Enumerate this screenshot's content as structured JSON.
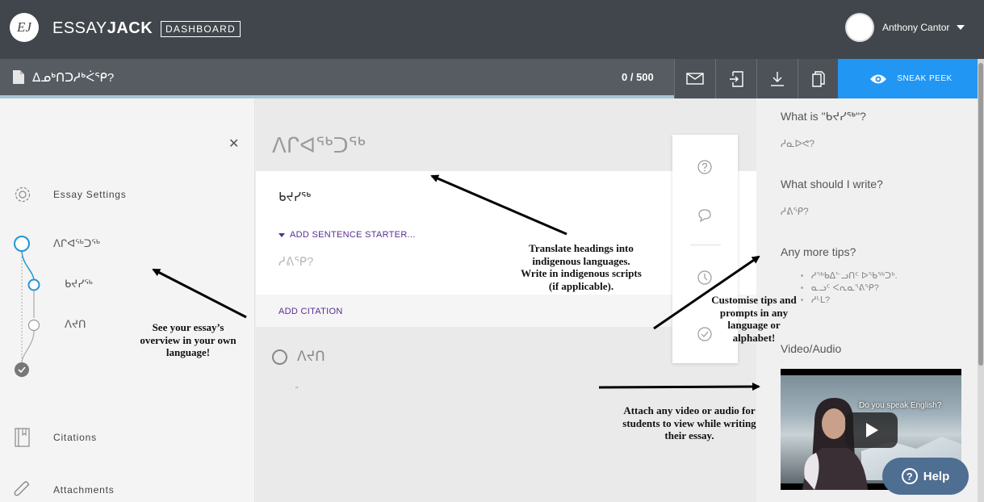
{
  "header": {
    "logo_text": "EJ",
    "brand_light": "ESSAY",
    "brand_bold": "JACK",
    "dashboard_label": "DASHBOARD",
    "user_name": "Anthony Cantor"
  },
  "docbar": {
    "title": "ᐃᓄᒃᑎᑐᓱᒃᐹᕿ?",
    "word_count": "0 / 500",
    "sneak_peek_label": "SNEAK PEEK"
  },
  "sidebar": {
    "settings_label": "Essay Settings",
    "outline": [
      "ᐱᒋᐊᖅᑐᖅ",
      "ᑲᔪᓯᖅ",
      "ᐱᔪᑎ"
    ],
    "citations_label": "Citations",
    "attachments_label": "Attachments"
  },
  "editor": {
    "section_title": "ᐱᒋᐊᖅᑐᖅ",
    "card_heading": "ᑲᔪᓯᖅ",
    "add_sentence_starter": "ADD SENTENCE STARTER...",
    "placeholder": "ᓱᕕᕿ?",
    "add_citation": "ADD CITATION",
    "next_section": "ᐱᔪᑎ",
    "tiny_quote": "\""
  },
  "tips": {
    "what_is_heading": "What is \"ᑲᔪᓯᖅ\"?",
    "what_is_text": "ᓱᓇᐅᕙ?",
    "what_write_heading": "What should I write?",
    "what_write_text": "ᓱᕕᕿ?",
    "more_tips_heading": "Any more tips?",
    "more_tips": [
      "ᓱᖅᑲᐃᓪᓗᑎᑦ ᐅᖃᖅᑐᒃ.",
      "ᓇᓗᑦ ᐸᕆᓇᕐᕕᕿ?",
      "ᓱᒻᒪ?"
    ],
    "video_heading": "Video/Audio",
    "video_caption": "Do you speak English?"
  },
  "annotations": {
    "sidebar_note": "See your essay’s overview in your own language!",
    "headings_note": "Translate headings into indigenous languages. Write in indigenous scripts (if applicable).",
    "tips_note": "Customise tips and prompts in any language or alphabet!",
    "video_note": "Attach any video or audio for students to view while writing their essay."
  },
  "help": {
    "label": "Help"
  },
  "colors": {
    "topbar": "#40464b",
    "accent_blue": "#2196f3",
    "purple_link": "#5a2d91",
    "outline_blue": "#2196d8",
    "help_button": "#4e6e92"
  }
}
